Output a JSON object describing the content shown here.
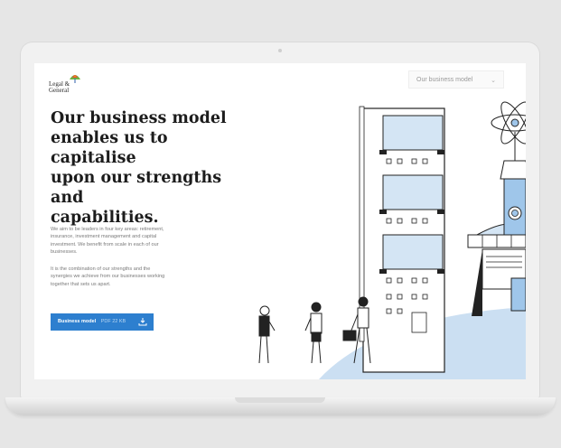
{
  "header": {
    "logo_line1": "Legal &",
    "logo_line2": "General",
    "nav_dropdown_value": "Our business model"
  },
  "hero": {
    "headline_lines": [
      "Our business model",
      "enables us to capitalise",
      "upon our strengths and",
      "capabilities."
    ],
    "paragraph1_lines": [
      "We aim to be leaders in four key areas: retirement,",
      "insurance, investment management and capital",
      "investment. We benefit from scale in each of our",
      "businesses."
    ],
    "paragraph2_lines": [
      "It is the combination of our strengths and the",
      "synergies we achieve from our businesses working",
      "together that sets us apart."
    ],
    "cta_label": "Business model",
    "cta_meta": "PDF 22 KB"
  },
  "colors": {
    "cta_blue": "#2d7fcf",
    "illustration_blue": "#cfe1f2",
    "ground_blue": "#c9def1"
  }
}
